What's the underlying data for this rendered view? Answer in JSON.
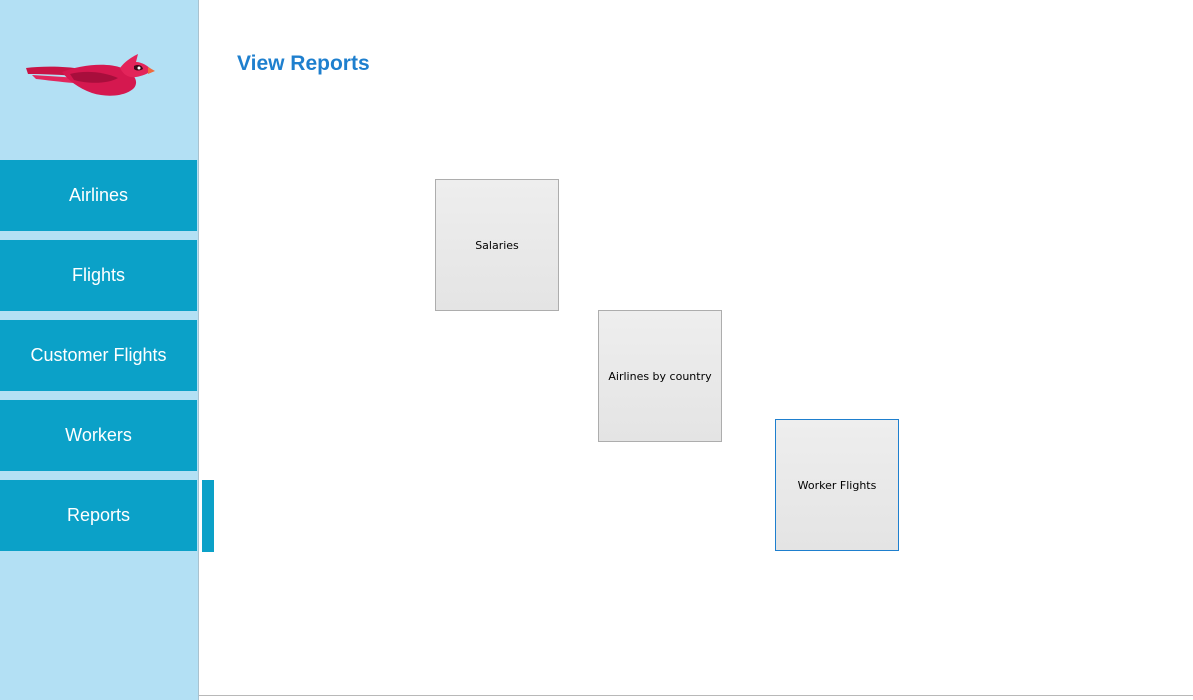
{
  "sidebar": {
    "logo_icon": "cardinal-bird-icon",
    "items": [
      {
        "label": "Airlines"
      },
      {
        "label": "Flights"
      },
      {
        "label": "Customer Flights"
      },
      {
        "label": "Workers"
      },
      {
        "label": "Reports"
      }
    ],
    "active_item": "Reports"
  },
  "main": {
    "title": "View Reports",
    "reports": [
      {
        "label": "Salaries"
      },
      {
        "label": "Airlines by country"
      },
      {
        "label": "Worker Flights"
      }
    ],
    "focused_report": "Worker Flights"
  },
  "colors": {
    "sidebar_bg": "#b3e0f4",
    "nav_item_bg": "#0ba1c8",
    "title_color": "#1e7fce",
    "logo_red": "#d5184f"
  }
}
